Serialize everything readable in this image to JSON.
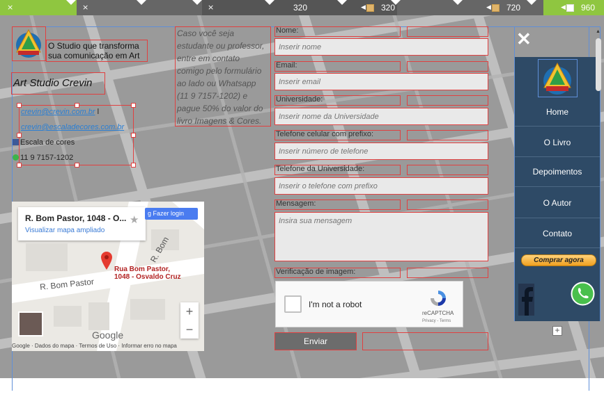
{
  "breakpoints": {
    "close_glyph": "×",
    "labels": [
      "320",
      "320",
      "720",
      "960"
    ]
  },
  "header": {
    "tagline": "O Studio que transforma sua comunicação em Art",
    "brand": "Art Studio Crevin"
  },
  "contact": {
    "email1": "crevin@crevin.com.br",
    "email1_suffix": "l",
    "email2": "crevin@escaladecores.com.br",
    "facebook": "Escala de cores",
    "phone": "11 9 7157-1202"
  },
  "map": {
    "title": "R. Bom Pastor, 1048 - O...",
    "link": "Visualizar mapa ampliado",
    "login": "Fazer login",
    "pin_label_1": "Rua Bom Pastor,",
    "pin_label_2": "1048 - Osvaldo Cruz",
    "street": "R. Bom Pastor",
    "street2": "R. Bom",
    "zoom_in": "+",
    "zoom_out": "−",
    "google": "Google",
    "footer": "Google · Dados do mapa · Termos de Uso · Informar erro no mapa"
  },
  "promo": {
    "text": "Caso você seja estudante ou professor, entre em contato comigo pelo formulário ao lado ou Whatsapp (11 9 7157-1202) e pague 50% do valor do livro Imagens & Cores."
  },
  "form": {
    "name_label": "Nome:",
    "name_placeholder": "Inserir nome",
    "email_label": "Email:",
    "email_placeholder": "Inserir email",
    "university_label": "Universidade:",
    "university_placeholder": "Inserir nome da Universidade",
    "phone_label": "Telefone celular com prefixo:",
    "phone_placeholder": "Inserir número de telefone",
    "uni_phone_label": "Telefone da Universidade:",
    "uni_phone_placeholder": "Inserir o telefone com prefixo",
    "message_label": "Mensagem:",
    "message_placeholder": "Insira sua mensagem",
    "captcha_label": "Verificação de imagem:",
    "captcha_text": "I'm not a robot",
    "captcha_brand": "reCAPTCHA",
    "captcha_terms": "Privacy - Terms",
    "submit": "Enviar"
  },
  "nav": {
    "close": "✕",
    "items": [
      "Home",
      "O Livro",
      "Depoimentos",
      "O Autor",
      "Contato"
    ],
    "buy": "Comprar agora",
    "add": "+"
  },
  "colors": {
    "selection": "#e04040",
    "guide": "#5f8fd8",
    "nav_bg": "#2e4a66",
    "breakpoint_green": "#8fc640"
  }
}
